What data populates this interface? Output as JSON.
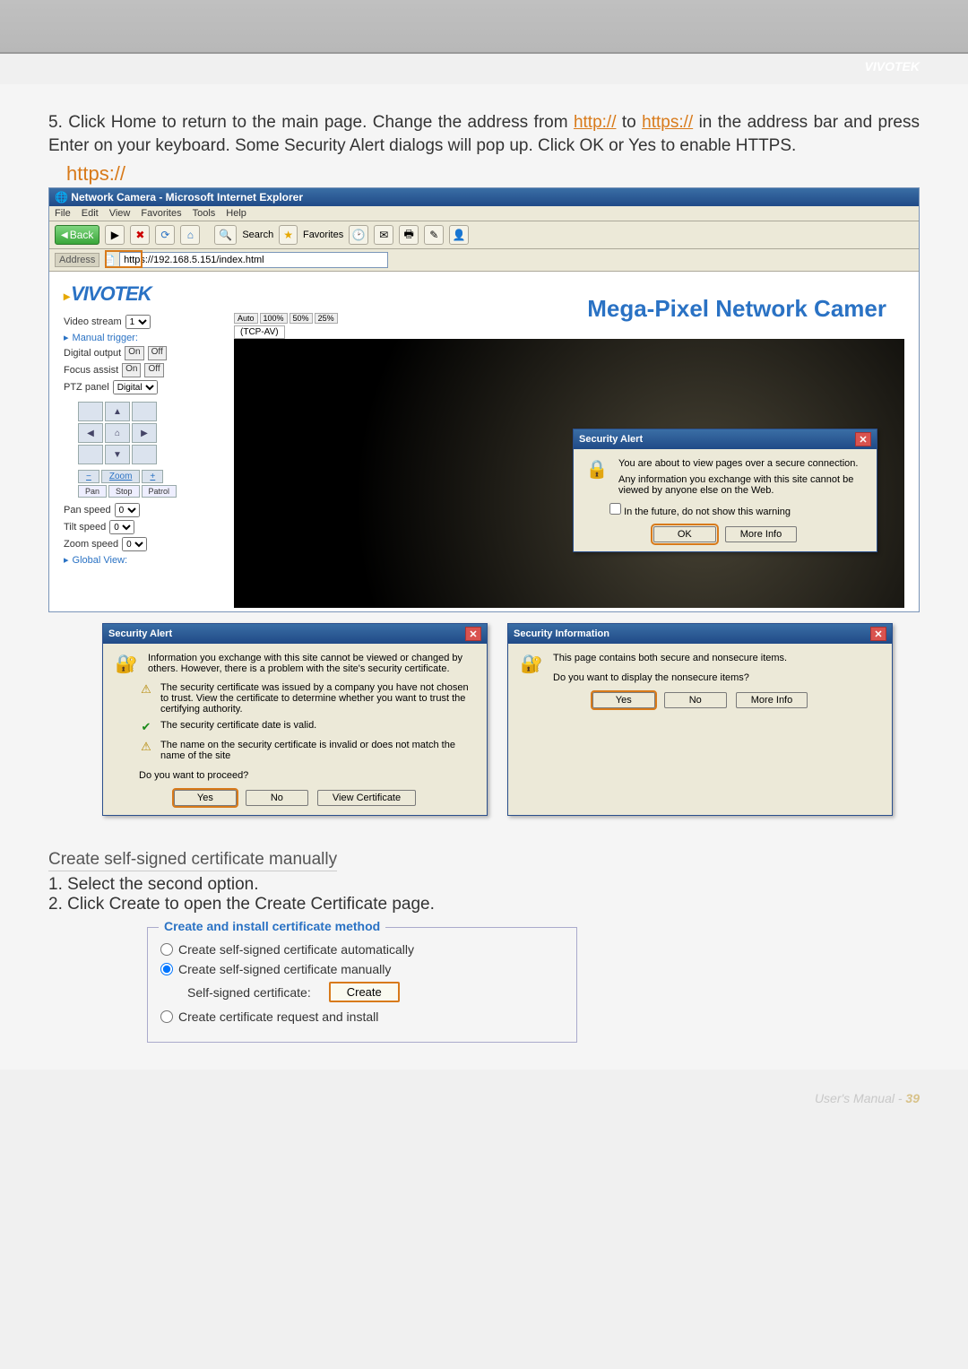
{
  "brand": "VIVOTEK",
  "step5": {
    "prefix": "5. Click Home to return to the main page. Change the address from ",
    "link1": "http://",
    "mid": " to ",
    "link2": "https://",
    "suffix": " in the address bar and press Enter on your keyboard. Some Security Alert dialogs will pop up. Click OK or Yes to enable HTTPS."
  },
  "https_label": "https://",
  "ie": {
    "title": "Network Camera - Microsoft Internet Explorer",
    "menu": [
      "File",
      "Edit",
      "View",
      "Favorites",
      "Tools",
      "Help"
    ],
    "back": "Back",
    "search": "Search",
    "favorites": "Favorites",
    "addr_label": "Address",
    "address": "https://192.168.5.151/index.html"
  },
  "header_title": "Mega-Pixel Network Camer",
  "sidebar": {
    "video_stream": "Video stream",
    "video_stream_val": "1",
    "manual_trigger": "Manual trigger:",
    "digital_output": "Digital output",
    "on": "On",
    "off": "Off",
    "focus_assist": "Focus assist",
    "ptz_panel": "PTZ panel",
    "ptz_mode": "Digital",
    "zoom": "Zoom",
    "pan": "Pan",
    "stop": "Stop",
    "patrol": "Patrol",
    "pan_speed": "Pan speed",
    "tilt_speed": "Tilt speed",
    "zoom_speed": "Zoom speed",
    "speed_val": "0",
    "global_view": "Global View:"
  },
  "zoombar": [
    "Auto",
    "100%",
    "50%",
    "25%"
  ],
  "tcp": "(TCP-AV)",
  "alert_overlay": {
    "title": "Security Alert",
    "l1": "You are about to view pages over a secure connection.",
    "l2": "Any information you exchange with this site cannot be viewed by anyone else on the Web.",
    "chk": "In the future, do not show this warning",
    "ok": "OK",
    "more": "More Info"
  },
  "alert_cert": {
    "title": "Security Alert",
    "intro": "Information you exchange with this site cannot be viewed or changed by others. However, there is a problem with the site's security certificate.",
    "c1": "The security certificate was issued by a company you have not chosen to trust. View the certificate to determine whether you want to trust the certifying authority.",
    "c2": "The security certificate date is valid.",
    "c3": "The name on the security certificate is invalid or does not match the name of the site",
    "proceed": "Do you want to proceed?",
    "yes": "Yes",
    "no": "No",
    "view": "View Certificate"
  },
  "sec_info": {
    "title": "Security Information",
    "l1": "This page contains both secure and nonsecure items.",
    "l2": "Do you want to display the nonsecure items?",
    "yes": "Yes",
    "no": "No",
    "more": "More Info"
  },
  "manual": {
    "heading": "Create self-signed certificate manually",
    "s1": "1. Select the second option.",
    "s2": "2. Click Create to open the Create Certificate page."
  },
  "certbox": {
    "legend": "Create and install certificate method",
    "o1": "Create self-signed certificate automatically",
    "o2": "Create self-signed certificate manually",
    "self_label": "Self-signed certificate:",
    "create": "Create",
    "o3": "Create certificate request and install"
  },
  "footer": {
    "txt": "User's Manual - ",
    "page": "39"
  }
}
